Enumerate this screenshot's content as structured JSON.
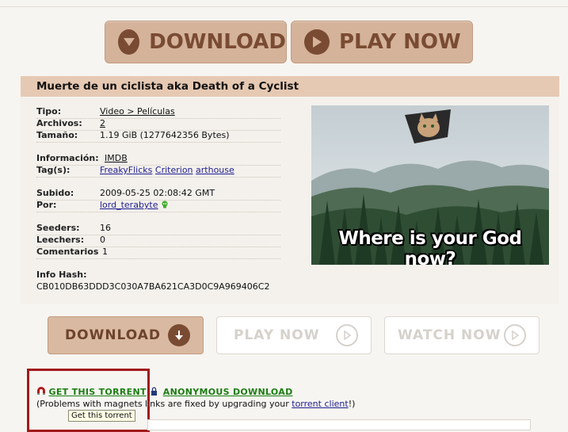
{
  "top_buttons": {
    "download": "DOWNLOAD",
    "play_now": "PLAY NOW"
  },
  "torrent_title": "Muerte de un ciclista aka Death of a Cyclist",
  "details": {
    "tipo_label": "Tipo:",
    "tipo_value": "Video > Películas",
    "archivos_label": "Archivos:",
    "archivos_value": "2",
    "tamano_label": "Tamaño:",
    "tamano_value": "1.19 GiB (1277642356 Bytes)",
    "informacion_label": "Información:",
    "informacion_value": "IMDB",
    "tags_label": "Tag(s):",
    "tags": [
      "FreakyFlicks",
      "Criterion",
      "arthouse"
    ],
    "subido_label": "Subido:",
    "subido_value": "2009-05-25 02:08:42 GMT",
    "por_label": "Por:",
    "por_value": "lord_terabyte",
    "seeders_label": "Seeders:",
    "seeders_value": "16",
    "leechers_label": "Leechers:",
    "leechers_value": "0",
    "comentarios_label": "Comentarios",
    "comentarios_value": "1",
    "infohash_label": "Info Hash:",
    "infohash_value": "CB010DB63DDD3C030A7BA621CA3D0C9A969406C2"
  },
  "meme_caption": "Where is your God now?",
  "action_buttons": {
    "download": "DOWNLOAD",
    "play_now": "PLAY NOW",
    "watch_now": "WATCH NOW"
  },
  "links": {
    "get_torrent": "GET THIS TORRENT",
    "anonymous": "ANONYMOUS DOWNLOAD",
    "note_prefix": "(Problems with magnets links are fixed by upgrading your ",
    "note_link": "torrent client",
    "note_suffix": "!)",
    "tooltip": "Get this torrent"
  },
  "colors": {
    "button_tan": "#d4b39a",
    "button_brown_text": "#7a4b33",
    "title_bar": "#e6c9b3",
    "link_blue": "#1e1d8f",
    "download_green": "#1b7d12",
    "highlight_red": "#a01a1a"
  }
}
